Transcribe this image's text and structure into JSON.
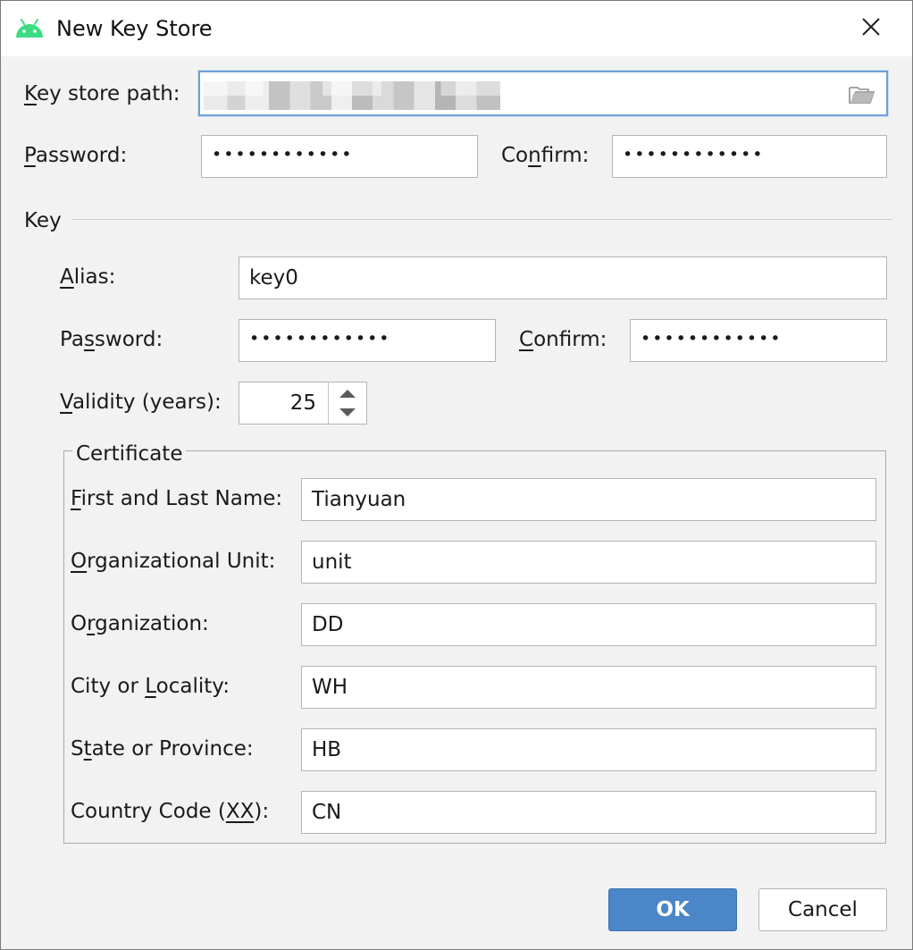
{
  "window": {
    "title": "New Key Store"
  },
  "keystore": {
    "path_label_pre": "",
    "path_label_u": "K",
    "path_label_post": "ey store path:",
    "password_label_u": "P",
    "password_label_post": "assword:",
    "password_value": "••••••••••••",
    "confirm_label_pre": "Co",
    "confirm_label_u": "n",
    "confirm_label_post": "firm:",
    "confirm_value": "••••••••••••"
  },
  "key": {
    "section_label": "Key",
    "alias_label_u": "A",
    "alias_label_post": "lias:",
    "alias_value": "key0",
    "password_label_pre": "Pa",
    "password_label_u": "s",
    "password_label_post": "sword:",
    "password_value": "••••••••••••",
    "confirm_label_u": "C",
    "confirm_label_post": "onfirm:",
    "confirm_value": "••••••••••••",
    "validity_label_u": "V",
    "validity_label_post": "alidity (years):",
    "validity_value": "25"
  },
  "certificate": {
    "legend": "Certificate",
    "fields": [
      {
        "label_pre": "",
        "label_u": "F",
        "label_post": "irst and Last Name:",
        "value": "Tianyuan"
      },
      {
        "label_pre": "",
        "label_u": "O",
        "label_post": "rganizational Unit:",
        "value": "unit"
      },
      {
        "label_pre": "O",
        "label_u": "r",
        "label_post": "ganization:",
        "value": "DD"
      },
      {
        "label_pre": "City or ",
        "label_u": "L",
        "label_post": "ocality:",
        "value": "WH"
      },
      {
        "label_pre": "S",
        "label_u": "t",
        "label_post": "ate or Province:",
        "value": "HB"
      },
      {
        "label_pre": "Country Code (",
        "label_u": "XX",
        "label_post": "):",
        "value": "CN"
      }
    ]
  },
  "buttons": {
    "ok": "OK",
    "cancel": "Cancel"
  },
  "icons": {
    "app": "android-icon",
    "close": "close-icon",
    "folder": "folder-icon",
    "spinner_up": "triangle-up-icon",
    "spinner_down": "triangle-down-icon"
  },
  "colors": {
    "accent": "#4a86c8",
    "android_green": "#3ddc84",
    "focus_border": "#6ea1d4"
  }
}
